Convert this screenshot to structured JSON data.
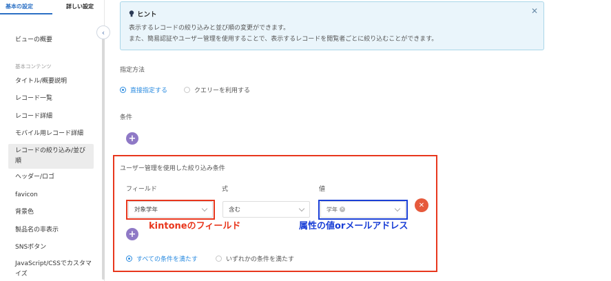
{
  "sidebar": {
    "tabs": [
      {
        "label": "基本の設定",
        "active": true
      },
      {
        "label": "詳しい設定",
        "active": false
      }
    ],
    "overview": "ビューの概要",
    "section_label": "基本コンテンツ",
    "items": [
      {
        "label": "タイトル/概要説明"
      },
      {
        "label": "レコード一覧"
      },
      {
        "label": "レコード詳細"
      },
      {
        "label": "モバイル用レコード詳細"
      },
      {
        "label": "レコードの絞り込み/並び順",
        "active": true
      },
      {
        "label": "ヘッダー/ロゴ"
      },
      {
        "label": "favicon"
      },
      {
        "label": "背景色"
      },
      {
        "label": "製品名の非表示"
      },
      {
        "label": "SNSボタン"
      },
      {
        "label": "JavaScript/CSSでカスタマイズ"
      }
    ],
    "collapse_icon": "chevron-left-icon"
  },
  "hint": {
    "title": "ヒント",
    "line1": "表示するレコードの絞り込みと並び順の変更ができます。",
    "line2": "また、簡易認証やユーザー管理を使用することで、表示するレコードを閲覧者ごとに絞り込むことができます。",
    "close_icon": "close-icon"
  },
  "method": {
    "label": "指定方法",
    "options": [
      {
        "label": "直接指定する",
        "selected": true
      },
      {
        "label": "クエリーを利用する",
        "selected": false
      }
    ]
  },
  "conditions": {
    "label": "条件"
  },
  "user_filter": {
    "title": "ユーザー管理を使用した絞り込み条件",
    "col_field": "フィールド",
    "col_expr": "式",
    "col_value": "値",
    "field_value": "対象学年",
    "expr_value": "含む",
    "value_tag": "学年",
    "match_options": [
      {
        "label": "すべての条件を満たす",
        "selected": true
      },
      {
        "label": "いずれかの条件を満たす",
        "selected": false
      }
    ]
  },
  "annotations": {
    "kintone_field": "kintoneのフィールド",
    "attribute_value": "属性の値orメールアドレス"
  },
  "colors": {
    "accent": "#2a8be0",
    "highlight_red": "#e8361c",
    "highlight_blue": "#1a3fd6",
    "add_button": "#8f79c6",
    "delete_button": "#e65a3c"
  }
}
